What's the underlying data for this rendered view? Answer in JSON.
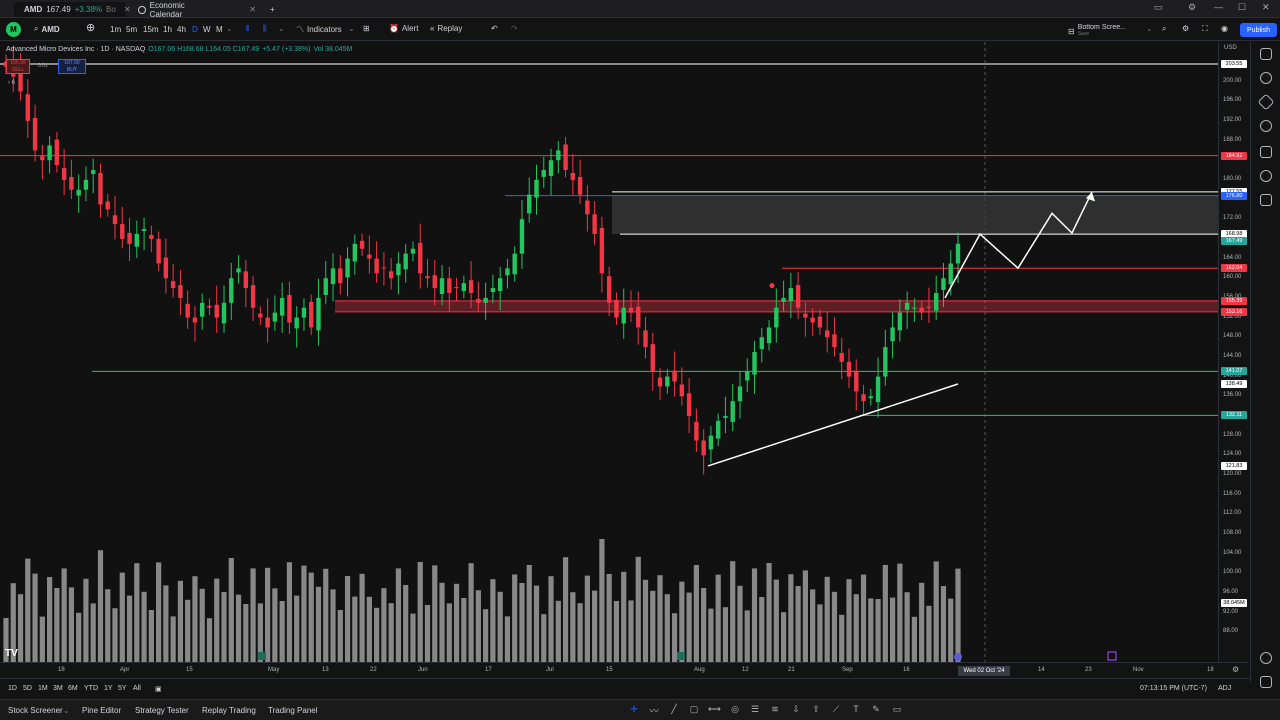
{
  "tabs": {
    "tab1": "AMD",
    "tab1_price": "167.49",
    "tab1_change": "+3.38%",
    "tab1_extra": "Bo",
    "tab2": "Economic Calendar",
    "new_tab": "+"
  },
  "toolbar": {
    "symbol": "AMD",
    "timeframes": [
      "1m",
      "5m",
      "15m",
      "1h",
      "4h",
      "D",
      "W",
      "M"
    ],
    "selected_timeframe": "D",
    "indicators": "Indicators",
    "alert": "Alert",
    "replay": "Replay",
    "layout_name": "Bottom Scree...",
    "layout_sub": "Save",
    "publish": "Publish"
  },
  "legend": {
    "title": "Advanced Micro Devices Inc · 1D · NASDAQ",
    "ohlc": "O167.06 H168.68 L164.05 C167.49",
    "change": "+5.47 (+3.38%)",
    "vol": "Vol 38.045M",
    "sell_price": "166.99",
    "sell_label": "SELL",
    "spread": "0.01",
    "buy_price": "167.00",
    "buy_label": "BUY",
    "collapse": "6"
  },
  "price_axis": {
    "currency": "USD",
    "ticks": [
      "200.00",
      "196.00",
      "192.00",
      "188.00",
      "184.00",
      "180.00",
      "176.00",
      "172.00",
      "168.00",
      "164.00",
      "160.00",
      "156.00",
      "152.00",
      "148.00",
      "144.00",
      "140.00",
      "136.00",
      "132.00",
      "128.00",
      "124.00",
      "120.00",
      "116.00",
      "112.00",
      "108.00",
      "104.00",
      "100.00",
      "96.00",
      "92.00",
      "88.00"
    ],
    "labels": [
      {
        "text": "203.55",
        "color": "#ffffff",
        "bg": "#ffffff",
        "fg": "#000000",
        "price": 203.55
      },
      {
        "text": "184.92",
        "color": "#f23645",
        "bg": "#f23645",
        "fg": "#ffffff",
        "price": 184.92
      },
      {
        "text": "177.55",
        "color": "#ffffff",
        "bg": "#ffffff",
        "fg": "#000000",
        "price": 177.55
      },
      {
        "text": "176.80",
        "color": "#2962ff",
        "bg": "#2962ff",
        "fg": "#ffffff",
        "price": 176.8
      },
      {
        "text": "168.98",
        "color": "#ffffff",
        "bg": "#ffffff",
        "fg": "#000000",
        "price": 168.98
      },
      {
        "text": "167.49",
        "color": "#26a69a",
        "bg": "#26a69a",
        "fg": "#ffffff",
        "price": 167.49
      },
      {
        "text": "162.04",
        "color": "#f23645",
        "bg": "#f23645",
        "fg": "#ffffff",
        "price": 162.04
      },
      {
        "text": "155.39",
        "color": "#f23645",
        "bg": "#f23645",
        "fg": "#ffffff",
        "price": 155.39
      },
      {
        "text": "153.16",
        "color": "#f23645",
        "bg": "#f23645",
        "fg": "#ffffff",
        "price": 153.16
      },
      {
        "text": "141.07",
        "color": "#26a69a",
        "bg": "#26a69a",
        "fg": "#ffffff",
        "price": 141.07
      },
      {
        "text": "138.49",
        "color": "#ffffff",
        "bg": "#ffffff",
        "fg": "#000000",
        "price": 138.49
      },
      {
        "text": "132.11",
        "color": "#26a69a",
        "bg": "#26a69a",
        "fg": "#ffffff",
        "price": 132.11
      },
      {
        "text": "121.83",
        "color": "#ffffff",
        "bg": "#ffffff",
        "fg": "#000000",
        "price": 121.83
      },
      {
        "text": "38.045M",
        "color": "#ffffff",
        "bg": "#ffffff",
        "fg": "#000000",
        "price": 94.0
      }
    ]
  },
  "time_axis": {
    "ticks": [
      "18",
      "Apr",
      "15",
      "May",
      "13",
      "22",
      "Jun",
      "17",
      "Jul",
      "15",
      "Aug",
      "12",
      "21",
      "Sep",
      "16",
      "14",
      "23",
      "Nov",
      "18"
    ],
    "crosshair": "Wed 02 Oct '24"
  },
  "bottom": {
    "ranges": [
      "1D",
      "5D",
      "1M",
      "3M",
      "6M",
      "YTD",
      "1Y",
      "5Y",
      "All"
    ],
    "time": "07:13:15 PM (UTC-7)",
    "adj": "ADJ"
  },
  "panels": {
    "items": [
      "Stock Screener",
      "Pine Editor",
      "Strategy Tester",
      "Replay Trading",
      "Trading Panel"
    ]
  },
  "colors": {
    "up": "#26a69a",
    "up_bright": "#22c55e",
    "down": "#f23645",
    "accent": "#2962ff"
  },
  "chart_data": {
    "type": "candlestick",
    "title": "Advanced Micro Devices Inc · 1D · NASDAQ",
    "ylim": [
      84,
      206
    ],
    "closes": [
      203,
      201,
      198,
      192,
      186,
      184,
      187,
      183,
      180,
      178,
      178,
      180,
      182,
      175,
      174,
      171,
      168,
      167,
      169,
      170,
      168,
      163,
      160,
      158,
      156,
      152,
      151,
      155,
      154,
      152,
      155,
      160,
      162,
      158,
      154,
      152,
      150,
      153,
      156,
      151,
      152,
      154,
      150,
      156,
      160,
      162,
      159,
      164,
      167,
      166,
      164,
      161,
      162,
      160,
      163,
      165,
      166,
      161,
      160,
      158,
      160,
      157,
      158,
      159,
      157,
      155,
      156,
      158,
      160,
      162,
      165,
      172,
      177,
      180,
      182,
      184,
      186,
      182,
      180,
      177,
      173,
      169,
      161,
      155,
      152,
      154,
      153,
      150,
      146,
      141,
      138,
      140,
      139,
      136,
      132,
      127,
      124,
      128,
      131,
      132,
      135,
      138,
      141,
      145,
      148,
      150,
      154,
      156,
      158,
      154,
      152,
      151,
      150,
      148,
      146,
      143,
      140,
      137,
      135,
      136,
      140,
      146,
      150,
      153,
      155,
      154,
      153,
      154,
      157,
      160,
      163,
      167
    ],
    "volume_scale": "relative"
  }
}
